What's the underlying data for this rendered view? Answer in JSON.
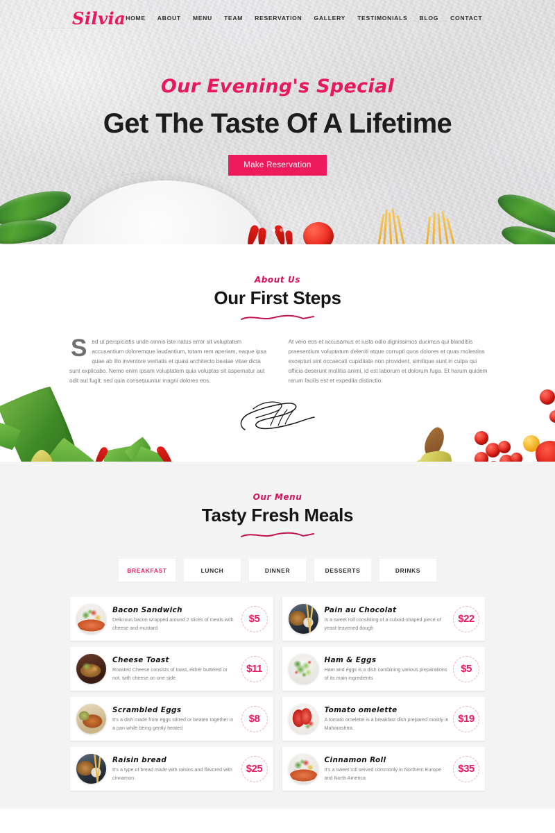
{
  "site": {
    "logo": "Silvia"
  },
  "nav": {
    "items": [
      {
        "label": "HOME",
        "name": "nav-home"
      },
      {
        "label": "ABOUT",
        "name": "nav-about"
      },
      {
        "label": "MENU",
        "name": "nav-menu"
      },
      {
        "label": "TEAM",
        "name": "nav-team"
      },
      {
        "label": "RESERVATION",
        "name": "nav-reservation"
      },
      {
        "label": "GALLERY",
        "name": "nav-gallery"
      },
      {
        "label": "TESTIMONIALS",
        "name": "nav-testimonials"
      },
      {
        "label": "BLOG",
        "name": "nav-blog"
      },
      {
        "label": "CONTACT",
        "name": "nav-contact"
      }
    ]
  },
  "hero": {
    "subtitle": "Our Evening's Special",
    "title": "Get The Taste Of A Lifetime",
    "button": "Make Reservation",
    "slider_dots": 2,
    "active_dot": 1
  },
  "about": {
    "eyebrow": "About Us",
    "title": "Our First Steps",
    "dropcap": "S",
    "left_text": "ed ut perspiciatis unde omnis iste natus error sit voluptatem accusantium doloremque laudantium, totam rem aperiam, eaque ipsa quae ab illo inventore veritatis et quasi architecto beatae vitae dicta sunt explicabo. Nemo enim ipsam voluptatem quia voluptas sit aspernatur aut odit aut fugit, sed quia consequuntur magni dolores eos.",
    "right_text": "At vero eos et accusamus et iusto odio dignissimos ducimus qui blanditiis praesentium voluptatum deleniti atque corrupti quos dolores et quas molestias excepturi sint occaecati cupiditate non provident, similique sunt in culpa qui officia deserunt mollitia animi, id est laborum et dolorum fuga. Et harum quidem rerum facilis est et expedita distinctio."
  },
  "menu": {
    "eyebrow": "Our Menu",
    "title": "Tasty Fresh Meals",
    "tabs": [
      {
        "label": "BREAKFAST",
        "active": true
      },
      {
        "label": "LUNCH",
        "active": false
      },
      {
        "label": "DINNER",
        "active": false
      },
      {
        "label": "DESSERTS",
        "active": false
      },
      {
        "label": "DRINKS",
        "active": false
      }
    ],
    "items": [
      {
        "title": "Bacon Sandwich",
        "desc": "Delicious bacon wrapped around 2 slices of meals with cheese and mustard",
        "price": "$5",
        "thumb": "salmon-veg-plate"
      },
      {
        "title": "Pain au Chocolat",
        "desc": "Is a sweet roll consisting of a cuboid-shaped piece of yeast-leavened dough",
        "price": "$22",
        "thumb": "burger-fries"
      },
      {
        "title": "Cheese Toast",
        "desc": "Roasted Cheese consists of toast, either buttered or not, with cheese on one side",
        "price": "$11",
        "thumb": "noodle-bowl"
      },
      {
        "title": "Ham & Eggs",
        "desc": "Ham and eggs is a dish combining various preparations of its main ingredients",
        "price": "$5",
        "thumb": "green-salad"
      },
      {
        "title": "Scrambled Eggs",
        "desc": "It's a dish made from eggs stirred or beaten together in a pan while being gently heated",
        "price": "$8",
        "thumb": "roast-meat"
      },
      {
        "title": "Tomato omelette",
        "desc": "A tomato omelette is a breakfast dish prepared mostly in Maharashtra.",
        "price": "$19",
        "thumb": "berry-smoothie"
      },
      {
        "title": "Raisin bread",
        "desc": "It's a type of bread made with raisins and flavored with cinnamon",
        "price": "$25",
        "thumb": "burger-fries"
      },
      {
        "title": "Cinnamon Roll",
        "desc": "It's a sweet roll served commonly in Northern Europe and North America",
        "price": "$35",
        "thumb": "salmon-veg-plate"
      }
    ]
  },
  "colors": {
    "accent_pink": "#e8185e",
    "button_pink": "#ed1a5d",
    "eyebrow_pink": "#d3135a",
    "heading_dark": "#151515",
    "body_gray": "#7d7d82",
    "menu_bg": "#f4f4f4",
    "card_bg": "#ffffff",
    "price_ring": "#f0a6c2"
  }
}
